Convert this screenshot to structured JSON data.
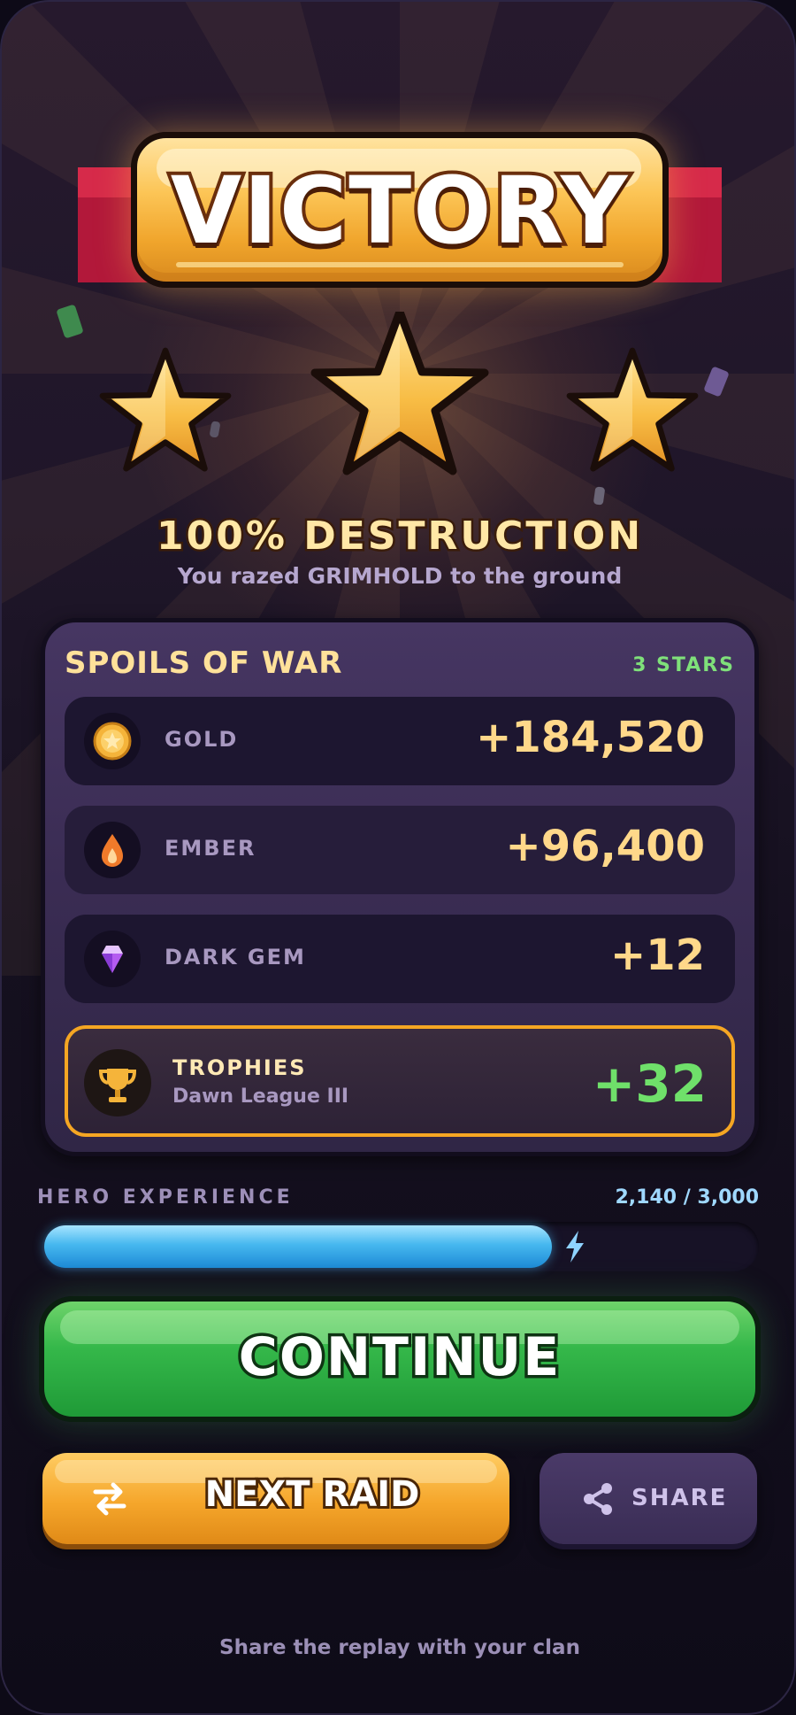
{
  "banner": {
    "title": "VICTORY"
  },
  "stars": {
    "earned": 3,
    "total": 3
  },
  "result": {
    "headline": "100% DESTRUCTION",
    "subtitle": "You razed GRIMHOLD to the ground"
  },
  "spoils": {
    "title": "SPOILS OF WAR",
    "stars_label": "3 STARS",
    "rows": [
      {
        "label": "GOLD",
        "value": "+184,520",
        "icon": "gold-coin-icon"
      },
      {
        "label": "EMBER",
        "value": "+96,400",
        "icon": "ember-flame-icon"
      },
      {
        "label": "DARK GEM",
        "value": "+12",
        "icon": "dark-gem-icon"
      }
    ],
    "trophies": {
      "label": "TROPHIES",
      "league": "Dawn League III",
      "value": "+32",
      "icon": "trophy-icon"
    }
  },
  "xp": {
    "label": "HERO EXPERIENCE",
    "value_text": "2,140 / 3,000",
    "current": 2140,
    "max": 3000
  },
  "buttons": {
    "continue": "CONTINUE",
    "next_raid": "NEXT RAID",
    "share": "SHARE"
  },
  "footer": {
    "text": "Share the replay with your clan"
  },
  "colors": {
    "gold": "#f5a623",
    "green": "#35b84a",
    "xp_blue": "#46b8ef",
    "panel": "#3a2c53"
  }
}
